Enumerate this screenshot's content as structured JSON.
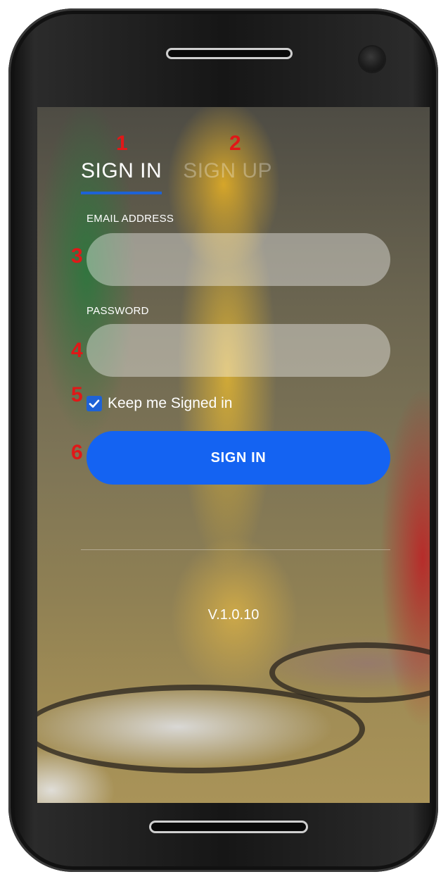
{
  "tabs": [
    {
      "label": "SIGN IN",
      "active": true
    },
    {
      "label": "SIGN UP",
      "active": false
    }
  ],
  "form": {
    "email_label": "EMAIL ADDRESS",
    "email_value": "",
    "email_placeholder": "",
    "password_label": "PASSWORD",
    "password_value": "",
    "password_placeholder": "",
    "remember_label": "Keep me Signed in",
    "remember_checked": true,
    "submit_label": "SIGN IN"
  },
  "footer": {
    "version": "V.1.0.10"
  },
  "markers": [
    "1",
    "2",
    "3",
    "4",
    "5",
    "6"
  ],
  "icons": {
    "checkbox": "checkmark-icon"
  },
  "colors": {
    "accent": "#1463f2",
    "tab_underline": "#1e62d6",
    "marker": "#e01818"
  }
}
